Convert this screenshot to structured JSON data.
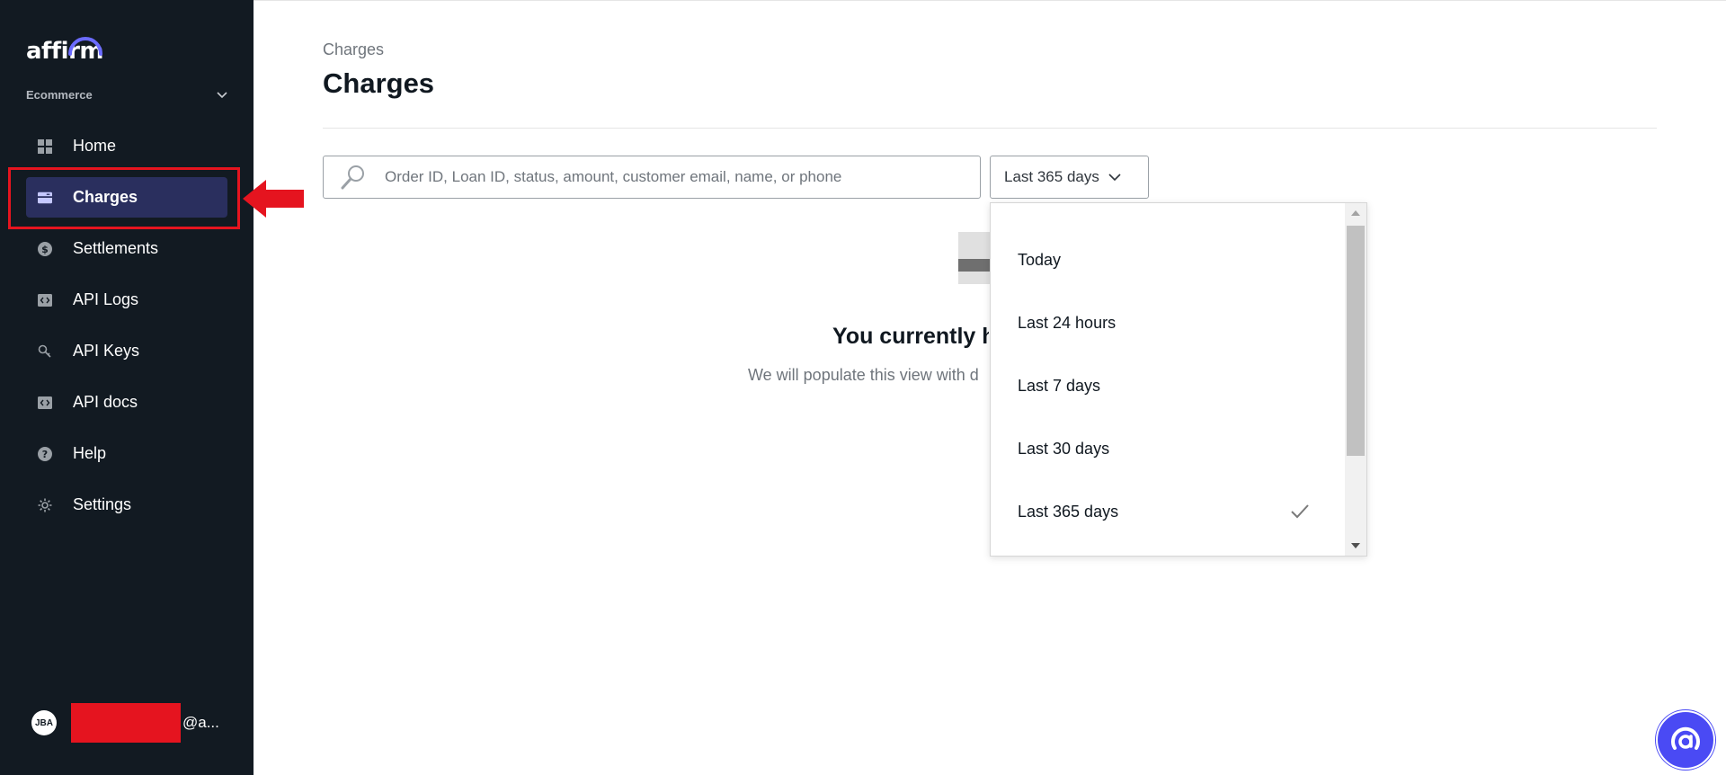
{
  "brand": {
    "logo_text": "affirm"
  },
  "org": {
    "label": "Ecommerce"
  },
  "nav": {
    "items": [
      {
        "label": "Home",
        "icon": "grid-icon"
      },
      {
        "label": "Charges",
        "icon": "card-icon",
        "active": true
      },
      {
        "label": "Settlements",
        "icon": "dollar-icon"
      },
      {
        "label": "API Logs",
        "icon": "code-icon"
      },
      {
        "label": "API Keys",
        "icon": "key-icon"
      },
      {
        "label": "API docs",
        "icon": "code-icon"
      },
      {
        "label": "Help",
        "icon": "help-icon"
      },
      {
        "label": "Settings",
        "icon": "gear-icon"
      }
    ]
  },
  "user": {
    "initials": "JBA",
    "email_suffix": "@a..."
  },
  "page": {
    "breadcrumb": "Charges",
    "title": "Charges"
  },
  "search": {
    "placeholder": "Order ID, Loan ID, status, amount, customer email, name, or phone",
    "value": ""
  },
  "date_range": {
    "selected": "Last 365 days",
    "options": [
      "Today",
      "Last 24 hours",
      "Last 7 days",
      "Last 30 days",
      "Last 365 days"
    ]
  },
  "empty_state": {
    "title": "You currently h",
    "subtitle": "We will populate this view with d"
  },
  "colors": {
    "sidebar_bg": "#121a22",
    "active_nav_bg": "#2a2f5e",
    "annotation_red": "#e5141f",
    "chat_blue": "#4a4af4"
  }
}
